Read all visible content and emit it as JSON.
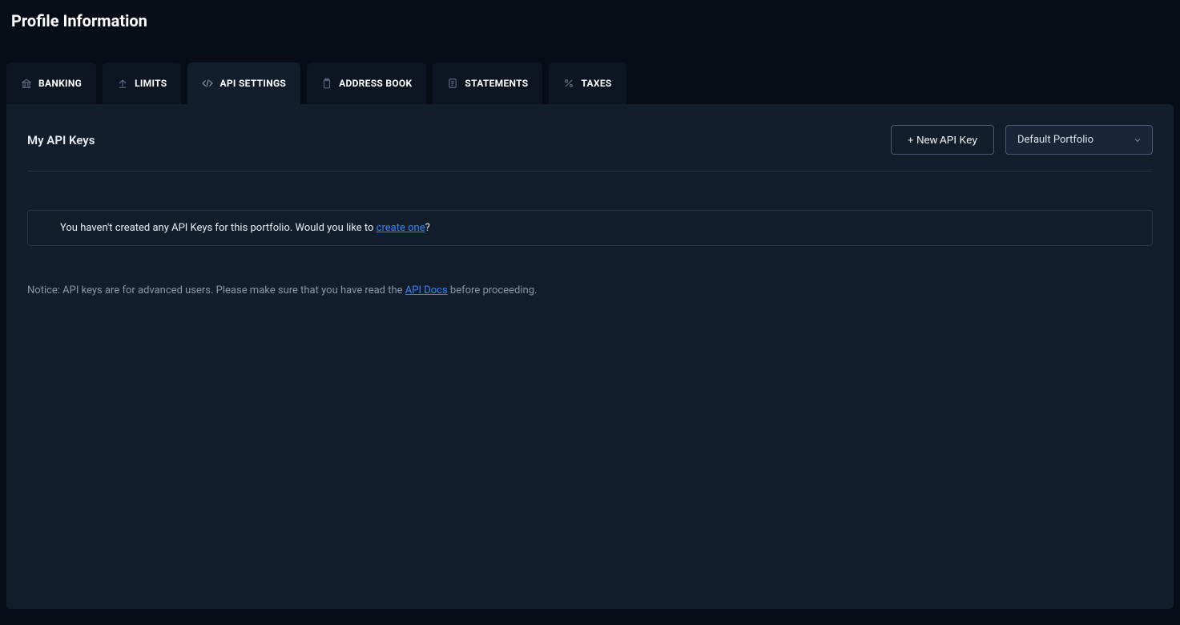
{
  "page_title": "Profile Information",
  "tabs": [
    {
      "label": "BANKING",
      "icon": "bank-icon"
    },
    {
      "label": "LIMITS",
      "icon": "upload-icon"
    },
    {
      "label": "API SETTINGS",
      "icon": "code-icon",
      "active": true
    },
    {
      "label": "ADDRESS BOOK",
      "icon": "clipboard-icon"
    },
    {
      "label": "STATEMENTS",
      "icon": "document-icon"
    },
    {
      "label": "TAXES",
      "icon": "percent-icon"
    }
  ],
  "section": {
    "title": "My API Keys",
    "new_api_key_label": "+ New API Key",
    "portfolio_selected": "Default Portfolio"
  },
  "empty_notice": {
    "prefix": "You haven't created any API Keys for this portfolio. Would you like to ",
    "link_text": "create one",
    "suffix": "?"
  },
  "footer_notice": {
    "prefix": "Notice: API keys are for advanced users. Please make sure that you have read the ",
    "link_text": "API Docs",
    "suffix": " before proceeding."
  }
}
